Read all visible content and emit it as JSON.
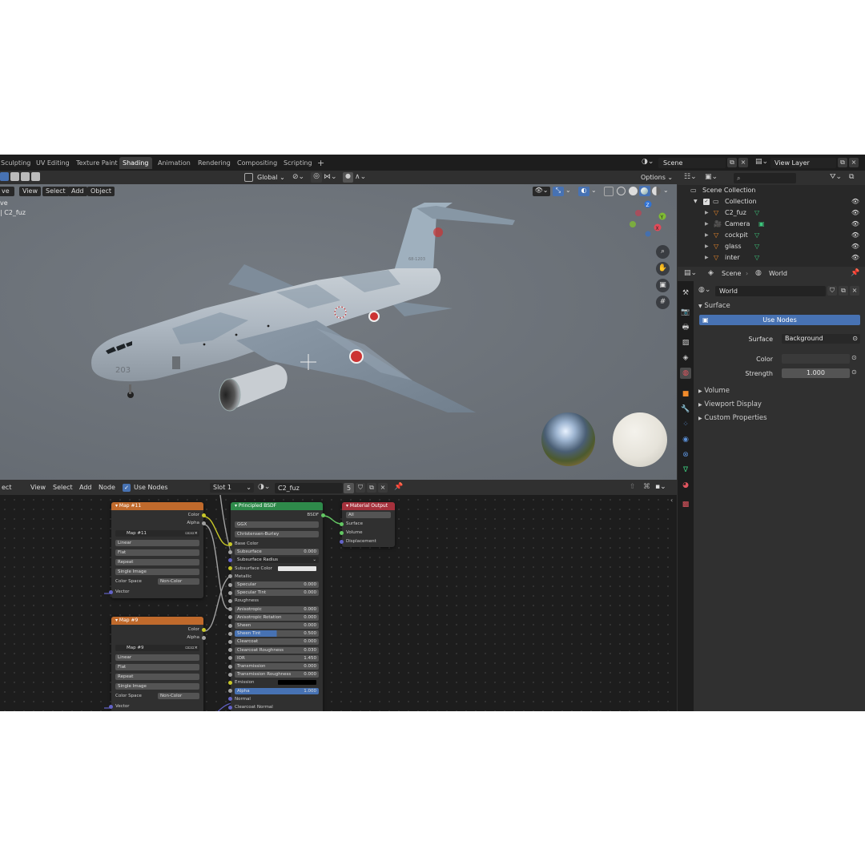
{
  "workspace_tabs": [
    "Sculpting",
    "UV Editing",
    "Texture Paint",
    "Shading",
    "Animation",
    "Rendering",
    "Compositing",
    "Scripting"
  ],
  "active_tab": "Shading",
  "add_tab_symbol": "+",
  "scene_selector": {
    "value": "Scene"
  },
  "view_layer_selector": {
    "value": "View Layer"
  },
  "viewport": {
    "transform_orientation": "Global",
    "options_label": "Options",
    "mode_label": "ve",
    "menu": [
      "View",
      "Select",
      "Add",
      "Object"
    ],
    "overlay_text": [
      "ve",
      "| C2_fuz"
    ],
    "aircraft_number": "203",
    "tail_text": "68-1203",
    "axis_labels": {
      "z": "Z",
      "y": "Y",
      "x": "X"
    }
  },
  "node_editor": {
    "header_left": "ect",
    "menu": [
      "View",
      "Select",
      "Add",
      "Node"
    ],
    "use_nodes_label": "Use Nodes",
    "slot": "Slot 1",
    "material_name": "C2_fuz",
    "user_count": "5",
    "image_nodes": [
      {
        "title": "Map #11",
        "outputs": [
          "Color",
          "Alpha"
        ],
        "image": "Map #11",
        "interpolation": "Linear",
        "projection": "Flat",
        "extension": "Repeat",
        "source": "Single Image",
        "color_space_label": "Color Space",
        "color_space": "Non-Color",
        "input": "Vector"
      },
      {
        "title": "Map #9",
        "outputs": [
          "Color",
          "Alpha"
        ],
        "image": "Map #9",
        "interpolation": "Linear",
        "projection": "Flat",
        "extension": "Repeat",
        "source": "Single Image",
        "color_space_label": "Color Space",
        "color_space": "Non-Color",
        "input": "Vector"
      }
    ],
    "bsdf": {
      "title": "Principled BSDF",
      "output": "BSDF",
      "distribution": "GGX",
      "subsurface_method": "Christensen-Burley",
      "rows": [
        {
          "label": "Base Color",
          "value": "",
          "kind": "plain",
          "sock": "#c7c729"
        },
        {
          "label": "Subsurface",
          "value": "0.000",
          "kind": "field",
          "sock": "#a1a1a1"
        },
        {
          "label": "Subsurface Radius",
          "value": "",
          "kind": "select",
          "sock": "#6363c7"
        },
        {
          "label": "Subsurface Color",
          "value": "",
          "kind": "color",
          "sock": "#c7c729"
        },
        {
          "label": "Metallic",
          "value": "",
          "kind": "plain",
          "sock": "#a1a1a1"
        },
        {
          "label": "Specular",
          "value": "0.000",
          "kind": "field",
          "sock": "#a1a1a1"
        },
        {
          "label": "Specular Tint",
          "value": "0.000",
          "kind": "field",
          "sock": "#a1a1a1"
        },
        {
          "label": "Roughness",
          "value": "",
          "kind": "plain",
          "sock": "#a1a1a1"
        },
        {
          "label": "Anisotropic",
          "value": "0.000",
          "kind": "field",
          "sock": "#a1a1a1"
        },
        {
          "label": "Anisotropic Rotation",
          "value": "0.000",
          "kind": "field",
          "sock": "#a1a1a1"
        },
        {
          "label": "Sheen",
          "value": "0.000",
          "kind": "field",
          "sock": "#a1a1a1"
        },
        {
          "label": "Sheen Tint",
          "value": "0.500",
          "kind": "blue",
          "sock": "#a1a1a1"
        },
        {
          "label": "Clearcoat",
          "value": "0.000",
          "kind": "field",
          "sock": "#a1a1a1"
        },
        {
          "label": "Clearcoat Roughness",
          "value": "0.030",
          "kind": "field",
          "sock": "#a1a1a1"
        },
        {
          "label": "IOR",
          "value": "1.450",
          "kind": "field",
          "sock": "#a1a1a1"
        },
        {
          "label": "Transmission",
          "value": "0.000",
          "kind": "field",
          "sock": "#a1a1a1"
        },
        {
          "label": "Transmission Roughness",
          "value": "0.000",
          "kind": "field",
          "sock": "#a1a1a1"
        },
        {
          "label": "Emission",
          "value": "",
          "kind": "black",
          "sock": "#c7c729"
        },
        {
          "label": "Alpha",
          "value": "1.000",
          "kind": "fullblue",
          "sock": "#a1a1a1"
        },
        {
          "label": "Normal",
          "value": "",
          "kind": "plain",
          "sock": "#6363c7"
        },
        {
          "label": "Clearcoat Normal",
          "value": "",
          "kind": "plain",
          "sock": "#6363c7"
        }
      ]
    },
    "output_node": {
      "title": "Material Output",
      "target": "All",
      "inputs": [
        "Surface",
        "Volume",
        "Displacement"
      ]
    }
  },
  "outliner": {
    "root": "Scene Collection",
    "collection": "Collection",
    "items": [
      "C2_fuz",
      "Camera",
      "cockpit",
      "glass",
      "inter"
    ]
  },
  "properties": {
    "breadcrumb": [
      "Scene",
      "World"
    ],
    "world_name": "World",
    "surface_panel": "Surface",
    "use_nodes_button": "Use Nodes",
    "surface_label": "Surface",
    "surface_value": "Background",
    "color_label": "Color",
    "strength_label": "Strength",
    "strength_value": "1.000",
    "collapsed_panels": [
      "Volume",
      "Viewport Display",
      "Custom Properties"
    ]
  },
  "colors": {
    "active_blue": "#4772b3",
    "image_node_header": "#c06a2c",
    "bsdf_header": "#2e8a4a",
    "output_header": "#a5313c",
    "panel_bg": "#303030"
  }
}
